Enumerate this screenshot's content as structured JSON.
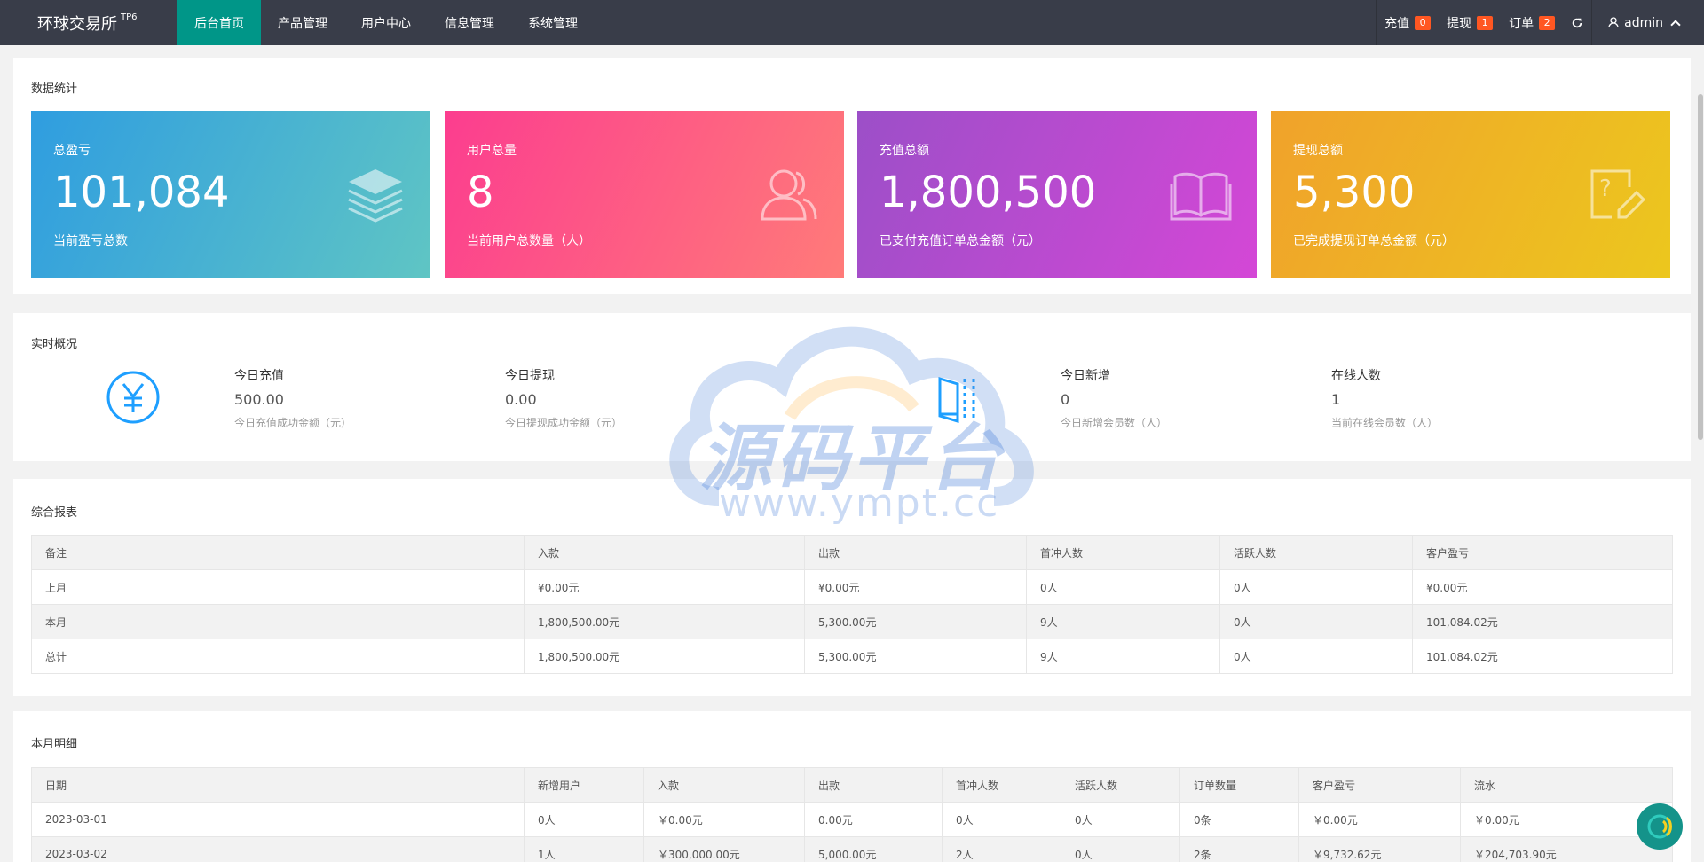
{
  "header": {
    "brand": "环球交易所",
    "brand_sup": "TP6",
    "nav": [
      "后台首页",
      "产品管理",
      "用户中心",
      "信息管理",
      "系统管理"
    ],
    "tools": {
      "recharge_label": "充值",
      "recharge_count": "0",
      "withdraw_label": "提现",
      "withdraw_count": "1",
      "order_label": "订单",
      "order_count": "2"
    },
    "user": "admin"
  },
  "stats": {
    "title": "数据统计",
    "cards": [
      {
        "label": "总盈亏",
        "value": "101,084",
        "desc": "当前盈亏总数",
        "icon": "layers-icon"
      },
      {
        "label": "用户总量",
        "value": "8",
        "desc": "当前用户总数量（人）",
        "icon": "users-icon"
      },
      {
        "label": "充值总额",
        "value": "1,800,500",
        "desc": "已支付充值订单总金额（元）",
        "icon": "book-icon"
      },
      {
        "label": "提现总额",
        "value": "5,300",
        "desc": "已完成提现订单总金额（元）",
        "icon": "question-edit-icon"
      }
    ]
  },
  "realtime": {
    "title": "实时概况",
    "items": [
      {
        "title": "今日充值",
        "value": "500.00",
        "desc": "今日充值成功金额（元）"
      },
      {
        "title": "今日提现",
        "value": "0.00",
        "desc": "今日提现成功金额（元）"
      },
      {
        "title": "今日新增",
        "value": "0",
        "desc": "今日新增会员数（人）"
      },
      {
        "title": "在线人数",
        "value": "1",
        "desc": "当前在线会员数（人）"
      }
    ]
  },
  "report": {
    "title": "综合报表",
    "headers": [
      "备注",
      "入款",
      "出款",
      "首冲人数",
      "活跃人数",
      "客户盈亏"
    ],
    "rows": [
      [
        "上月",
        "¥0.00元",
        "¥0.00元",
        "0人",
        "0人",
        "¥0.00元"
      ],
      [
        "本月",
        "1,800,500.00元",
        "5,300.00元",
        "9人",
        "0人",
        "101,084.02元"
      ],
      [
        "总计",
        "1,800,500.00元",
        "5,300.00元",
        "9人",
        "0人",
        "101,084.02元"
      ]
    ]
  },
  "monthly": {
    "title": "本月明细",
    "headers": [
      "日期",
      "新增用户",
      "入款",
      "出款",
      "首冲人数",
      "活跃人数",
      "订单数量",
      "客户盈亏",
      "流水"
    ],
    "rows": [
      [
        "2023-03-01",
        "0人",
        "￥0.00元",
        "0.00元",
        "0人",
        "0人",
        "0条",
        "￥0.00元",
        "￥0.00元"
      ],
      [
        "2023-03-02",
        "1人",
        "￥300,000.00元",
        "5,000.00元",
        "2人",
        "0人",
        "2条",
        "￥9,732.62元",
        "￥204,703.90元"
      ]
    ]
  },
  "watermark": {
    "text": "源码平台",
    "url": "www.ympt.cc"
  },
  "colors": {
    "topbar": "#393d49",
    "active_nav": "#009688",
    "badge": "#ff5722"
  }
}
